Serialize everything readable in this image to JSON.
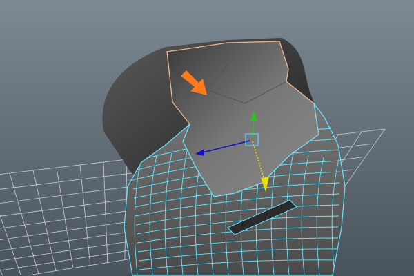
{
  "viewport": {
    "mode": "perspective-3d",
    "colors": {
      "bg_top": "#7d8993",
      "bg_bottom": "#49535c",
      "grid": "#c9cfd4",
      "mesh_dark": "#3a3a3a",
      "mesh_mid": "#6a6a6a",
      "wire_selected": "#66e6ff",
      "border_edge": "#f0b890",
      "annotation_arrow": "#ff7a1a",
      "axis_x": "#1010c8",
      "axis_y": "#2fc21f",
      "axis_z": "#e8e000",
      "pivot_box": "#4fd4ff"
    }
  },
  "icons": [
    "annotation-arrow-icon",
    "move-manipulator-icon"
  ]
}
